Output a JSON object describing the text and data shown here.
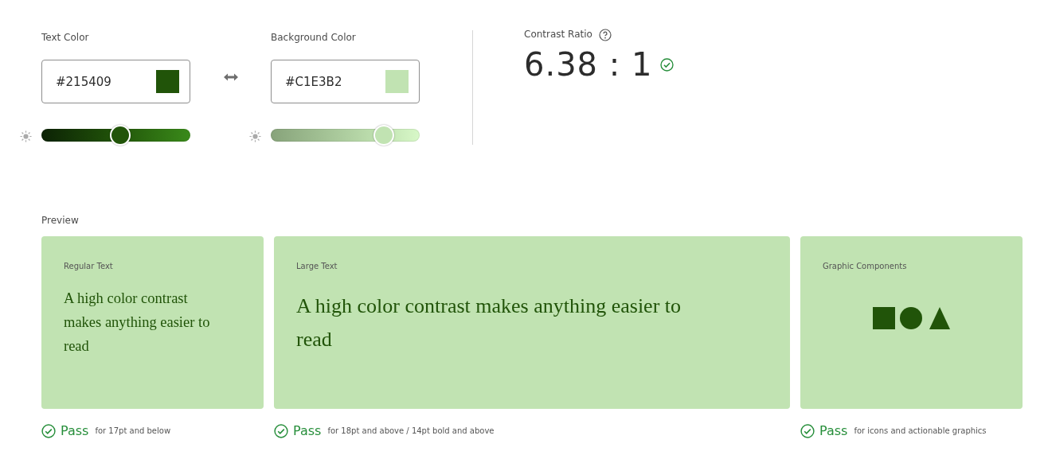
{
  "text_color": {
    "label": "Text Color",
    "value": "#215409",
    "level": 0.53
  },
  "background_color": {
    "label": "Background Color",
    "value": "#C1E3B2",
    "level": 0.76
  },
  "contrast": {
    "label": "Contrast Ratio",
    "ratio": "6.38 : 1",
    "passed": true
  },
  "preview": {
    "label": "Preview",
    "cards": [
      {
        "kind": "regular_text",
        "title": "Regular Text",
        "sample": "A high color contrast makes anything easier to read",
        "result": "Pass",
        "passed": true,
        "note": "for 17pt and below"
      },
      {
        "kind": "large_text",
        "title": "Large Text",
        "sample": "A high color contrast makes anything easier to read",
        "result": "Pass",
        "passed": true,
        "note": "for 18pt and above / 14pt bold and above"
      },
      {
        "kind": "graphic",
        "title": "Graphic Components",
        "result": "Pass",
        "passed": true,
        "note": "for icons and actionable graphics"
      }
    ]
  }
}
